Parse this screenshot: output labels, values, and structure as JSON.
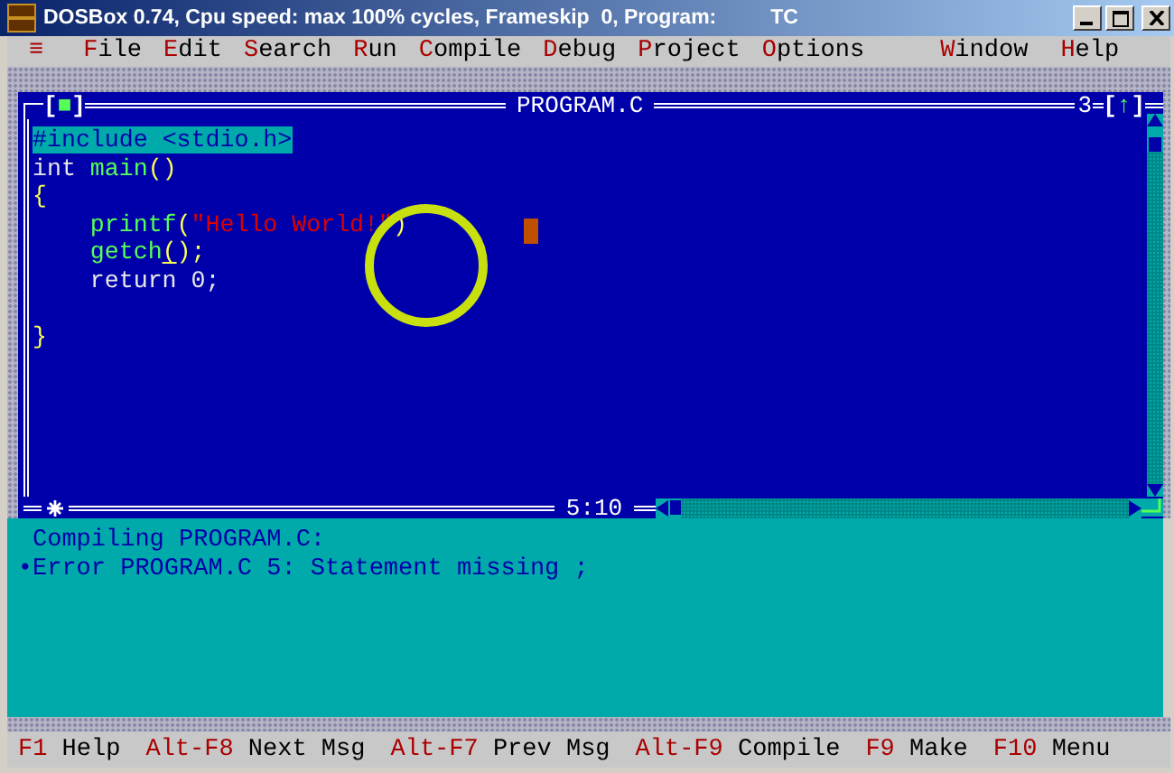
{
  "window": {
    "title": "DOSBox 0.74, Cpu speed: max 100% cycles, Frameskip  0, Program:",
    "program": "TC"
  },
  "menu": [
    {
      "label": "≡",
      "kind": "system"
    },
    {
      "label": "File",
      "kind": "menu"
    },
    {
      "label": "Edit",
      "kind": "menu"
    },
    {
      "label": "Search",
      "kind": "menu"
    },
    {
      "label": "Run",
      "kind": "menu"
    },
    {
      "label": "Compile",
      "kind": "menu"
    },
    {
      "label": "Debug",
      "kind": "menu"
    },
    {
      "label": "Project",
      "kind": "menu"
    },
    {
      "label": "Options",
      "kind": "menu"
    },
    {
      "label": "Window",
      "kind": "menu"
    },
    {
      "label": "Help",
      "kind": "menu"
    }
  ],
  "editor": {
    "close_button": "[■]",
    "title": "PROGRAM.C",
    "window_number": "3",
    "zoom_button": "[↑]",
    "cursor_position": "5:10",
    "lines": [
      {
        "highlighted": true,
        "indented": false,
        "tokens": [
          {
            "text": "#include <stdio.h>",
            "kind": "preprocessor"
          }
        ]
      },
      {
        "highlighted": false,
        "indented": false,
        "tokens": [
          {
            "text": "int ",
            "kind": "plain"
          },
          {
            "text": "main",
            "kind": "function"
          },
          {
            "text": "()",
            "kind": "punct"
          }
        ]
      },
      {
        "highlighted": false,
        "indented": false,
        "tokens": [
          {
            "text": "{",
            "kind": "punct"
          }
        ]
      },
      {
        "highlighted": false,
        "indented": true,
        "tokens": [
          {
            "text": "printf",
            "kind": "function"
          },
          {
            "text": "(",
            "kind": "punct"
          },
          {
            "text": "\"Hello World!\"",
            "kind": "string"
          },
          {
            "text": ")",
            "kind": "punct"
          }
        ]
      },
      {
        "highlighted": false,
        "indented": true,
        "tokens": [
          {
            "text": "getch",
            "kind": "function"
          },
          {
            "text": "(",
            "kind": "punct",
            "cursor": true
          },
          {
            "text": ");",
            "kind": "punct"
          }
        ]
      },
      {
        "highlighted": false,
        "indented": true,
        "tokens": [
          {
            "text": "return 0;",
            "kind": "plain"
          }
        ]
      },
      {
        "highlighted": false,
        "indented": false,
        "gap_before": true,
        "tokens": [
          {
            "text": "}",
            "kind": "punct"
          }
        ]
      }
    ]
  },
  "messages": [
    {
      "text": "Compiling PROGRAM.C:"
    },
    {
      "marker": "•",
      "text": "Error PROGRAM.C 5: Statement missing ;"
    }
  ],
  "status_bar": [
    {
      "key": "F1",
      "label": "Help"
    },
    {
      "key": "Alt-F8",
      "label": "Next Msg"
    },
    {
      "key": "Alt-F7",
      "label": "Prev Msg"
    },
    {
      "key": "Alt-F9",
      "label": "Compile"
    },
    {
      "key": "F9",
      "label": "Make"
    },
    {
      "key": "F10",
      "label": "Menu"
    }
  ]
}
